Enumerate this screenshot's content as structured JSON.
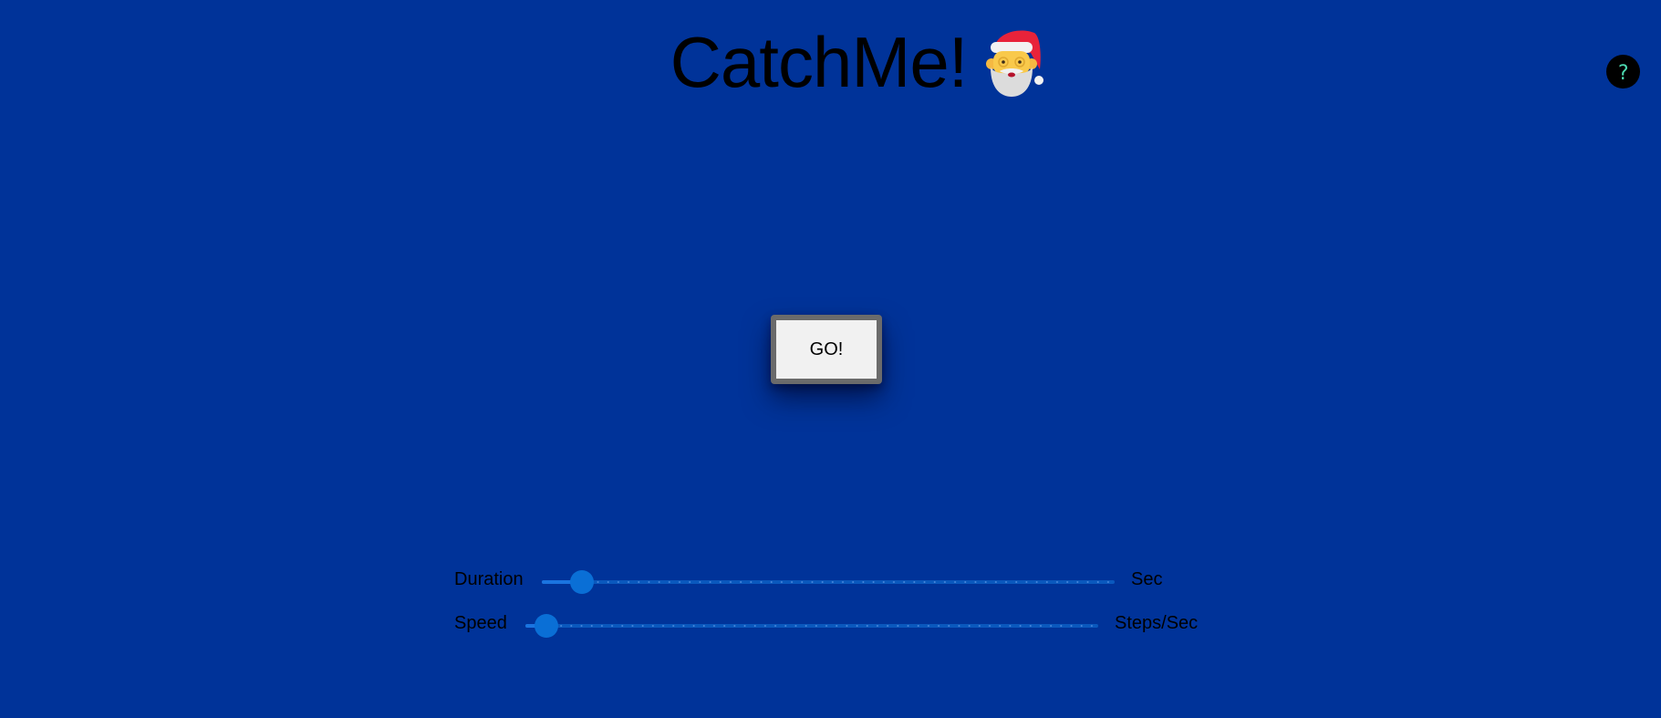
{
  "header": {
    "title": "CatchMe!",
    "santa_icon": "santa-claus-emoji",
    "help_label": "?"
  },
  "main": {
    "go_label": "GO!"
  },
  "controls": {
    "duration": {
      "label": "Duration",
      "unit": "Sec",
      "value_fraction": 0.07
    },
    "speed": {
      "label": "Speed",
      "unit": "Steps/Sec",
      "value_fraction": 0.037
    }
  },
  "colors": {
    "background": "#003399",
    "slider_track": "#0a58bd",
    "slider_thumb": "#0a6fd6",
    "help_text": "#4dd9b0"
  }
}
